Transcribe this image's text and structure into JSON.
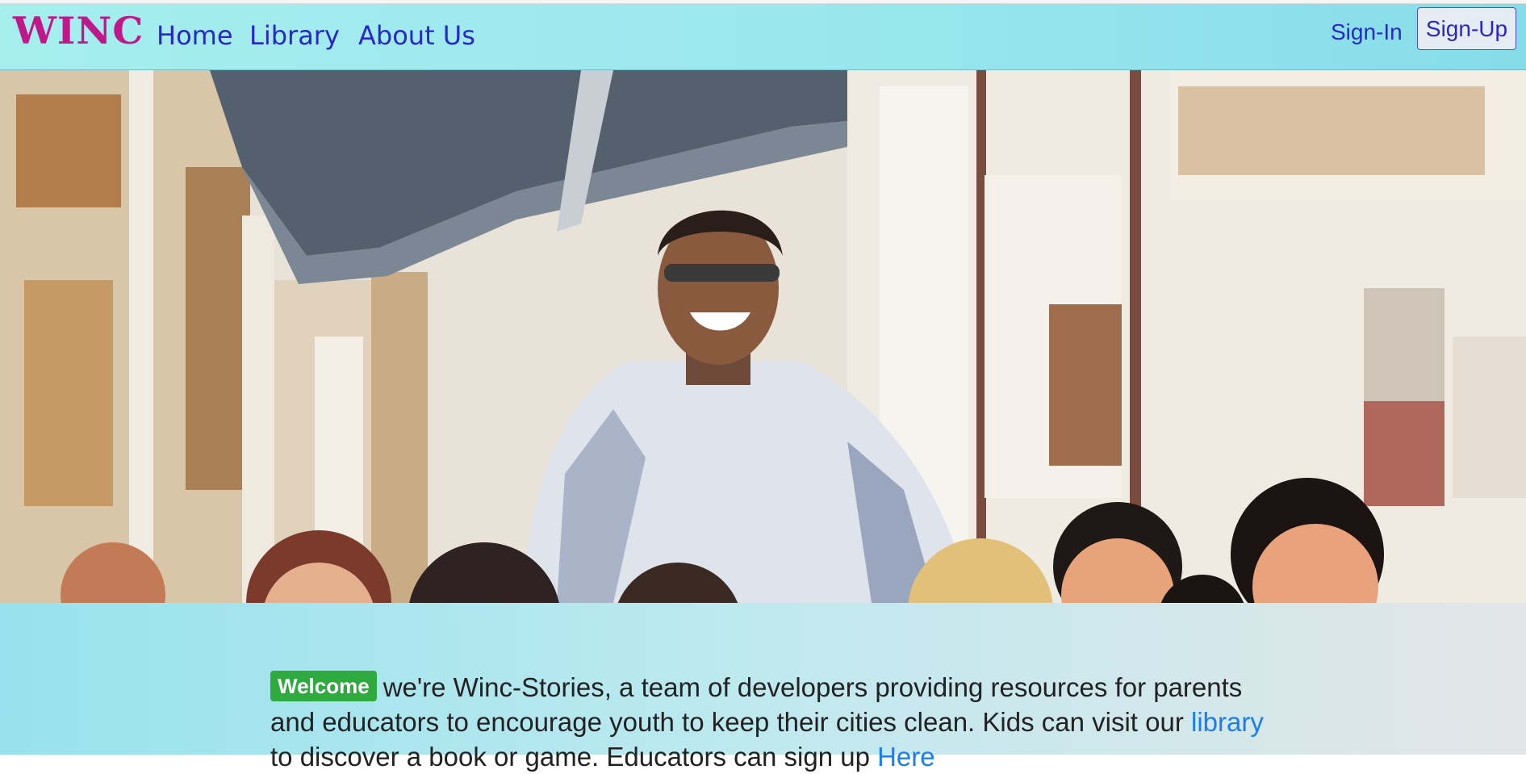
{
  "nav": {
    "brand": "WINC",
    "links": [
      "Home",
      "Library",
      "About Us"
    ],
    "sign_in": "Sign-In",
    "sign_up": "Sign-Up"
  },
  "hero": {
    "image": "illustration-teacher-with-children"
  },
  "intro": {
    "badge": "Welcome",
    "text_1": "we're Winc-Stories, a team of developers providing resources for parents and educators to encourage youth to keep their cities clean. Kids can visit our",
    "library_link": "library",
    "text_2": "to discover a book or game. Educators can sign up",
    "here_link": "Here"
  },
  "colors": {
    "brand": "#c0188a",
    "nav_link": "#2a27c8",
    "badge": "#2eaa3e",
    "inline_link": "#1a7ef2"
  }
}
